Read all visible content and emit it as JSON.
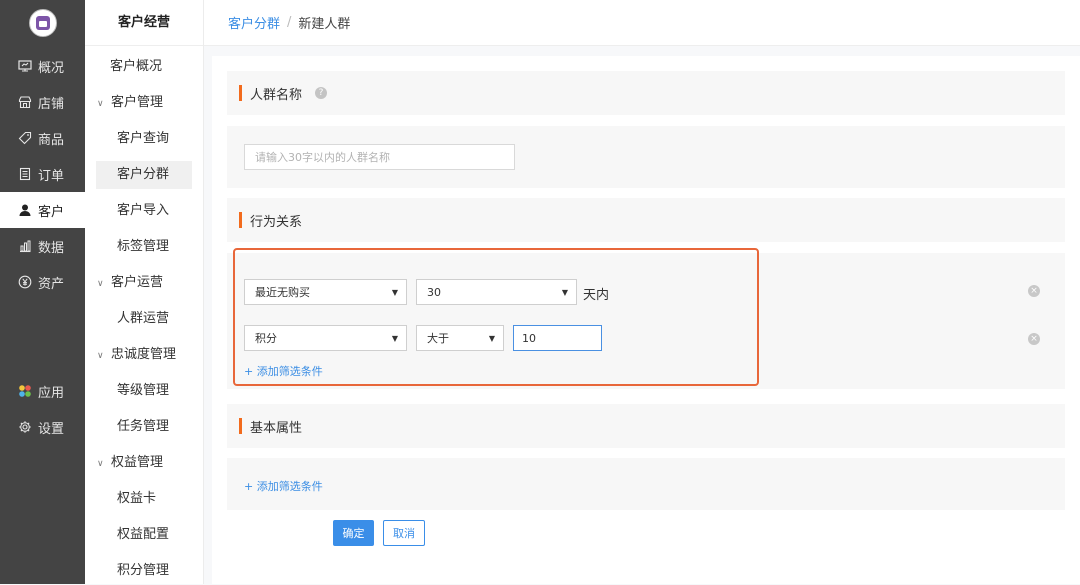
{
  "primary_nav": [
    {
      "label": "概况",
      "icon": "overview-icon",
      "active": false
    },
    {
      "label": "店铺",
      "icon": "store-icon",
      "active": false
    },
    {
      "label": "商品",
      "icon": "tag-icon",
      "active": false
    },
    {
      "label": "订单",
      "icon": "order-icon",
      "active": false
    },
    {
      "label": "客户",
      "icon": "user-icon",
      "active": true
    },
    {
      "label": "数据",
      "icon": "chart-icon",
      "active": false
    },
    {
      "label": "资产",
      "icon": "yen-icon",
      "active": false
    },
    {
      "label": "应用",
      "icon": "apps-icon",
      "active": false
    },
    {
      "label": "设置",
      "icon": "gear-icon",
      "active": false
    }
  ],
  "secondary_nav": {
    "title": "客户经营",
    "items": [
      {
        "label": "客户概况",
        "type": "top"
      },
      {
        "label": "客户管理",
        "type": "group"
      },
      {
        "label": "客户查询",
        "type": "sub"
      },
      {
        "label": "客户分群",
        "type": "sub",
        "active": true
      },
      {
        "label": "客户导入",
        "type": "sub"
      },
      {
        "label": "标签管理",
        "type": "sub"
      },
      {
        "label": "客户运营",
        "type": "group"
      },
      {
        "label": "人群运营",
        "type": "sub"
      },
      {
        "label": "忠诚度管理",
        "type": "group"
      },
      {
        "label": "等级管理",
        "type": "sub"
      },
      {
        "label": "任务管理",
        "type": "sub"
      },
      {
        "label": "权益管理",
        "type": "group"
      },
      {
        "label": "权益卡",
        "type": "sub"
      },
      {
        "label": "权益配置",
        "type": "sub"
      },
      {
        "label": "积分管理",
        "type": "sub"
      }
    ]
  },
  "breadcrumb": {
    "parent": "客户分群",
    "separator": "/",
    "current": "新建人群"
  },
  "form": {
    "name_section": {
      "title": "人群名称",
      "help_icon": "question-icon",
      "placeholder": "请输入30字以内的人群名称",
      "value": ""
    },
    "behavior_section": {
      "title": "行为关系",
      "conditions": [
        {
          "field": "最近无购买",
          "operator": "30",
          "unit": "天内"
        },
        {
          "field": "积分",
          "operator": "大于",
          "value": "10"
        }
      ],
      "add_label": "+ 添加筛选条件"
    },
    "attribute_section": {
      "title": "基本属性",
      "add_label": "+ 添加筛选条件"
    },
    "buttons": {
      "confirm": "确定",
      "cancel": "取消"
    }
  },
  "colors": {
    "accent": "#3a8ee8",
    "section_bar": "#f26b1d",
    "highlight": "#e8673a",
    "sidebar": "#444444"
  }
}
